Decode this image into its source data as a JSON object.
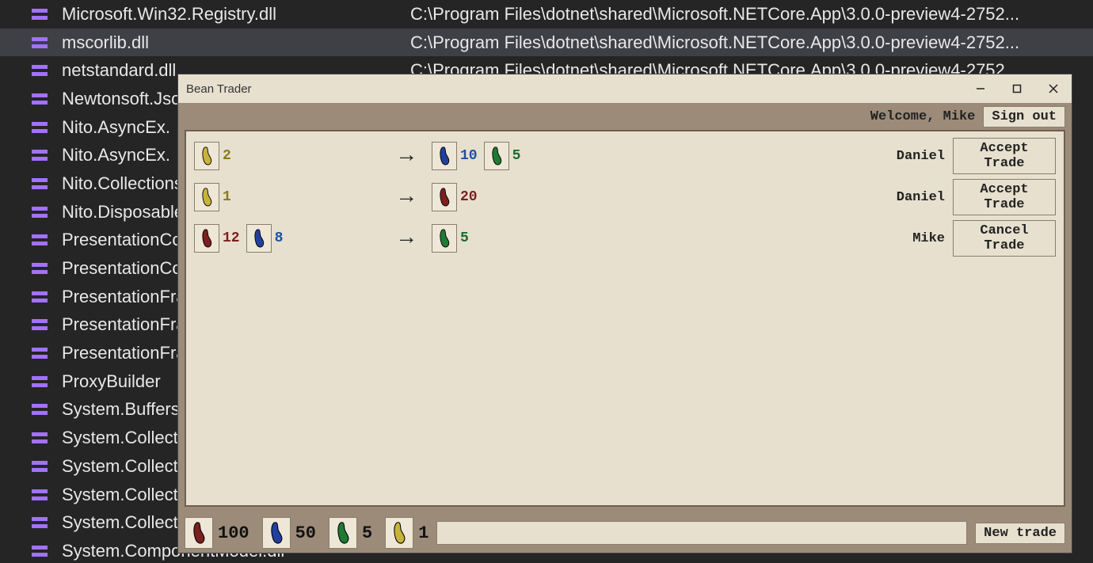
{
  "background": {
    "modules": [
      {
        "name": "Microsoft.Win32.Registry.dll",
        "path": "C:\\Program Files\\dotnet\\shared\\Microsoft.NETCore.App\\3.0.0-preview4-2752...",
        "selected": false
      },
      {
        "name": "mscorlib.dll",
        "path": "C:\\Program Files\\dotnet\\shared\\Microsoft.NETCore.App\\3.0.0-preview4-2752...",
        "selected": true
      },
      {
        "name": "netstandard.dll",
        "path": "C:\\Program Files\\dotnet\\shared\\Microsoft.NETCore.App\\3.0.0-preview4-2752...",
        "selected": false
      },
      {
        "name": "Newtonsoft.Json.dll",
        "path": "",
        "selected": false
      },
      {
        "name": "Nito.AsyncEx.",
        "path": "",
        "selected": false
      },
      {
        "name": "Nito.AsyncEx.",
        "path": "",
        "selected": false
      },
      {
        "name": "Nito.Collections.Deque.dll",
        "path": "",
        "selected": false
      },
      {
        "name": "Nito.Disposables.dll",
        "path": "",
        "selected": false
      },
      {
        "name": "PresentationCore.dll",
        "path": "",
        "selected": false
      },
      {
        "name": "PresentationCore.dll",
        "path": "",
        "selected": false
      },
      {
        "name": "PresentationFramework.dll",
        "path": "",
        "selected": false
      },
      {
        "name": "PresentationFramework.dll",
        "path": "",
        "selected": false
      },
      {
        "name": "PresentationFramework.dll",
        "path": "",
        "selected": false
      },
      {
        "name": "ProxyBuilder",
        "path": "",
        "selected": false
      },
      {
        "name": "System.Buffers.dll",
        "path": "",
        "selected": false
      },
      {
        "name": "System.Collections.dll",
        "path": "",
        "selected": false
      },
      {
        "name": "System.Collections.dll",
        "path": "",
        "selected": false
      },
      {
        "name": "System.Collections.dll",
        "path": "",
        "selected": false
      },
      {
        "name": "System.Collections.dll",
        "path": "",
        "selected": false
      },
      {
        "name": "System.ComponentModel.dll",
        "path": "",
        "selected": false
      }
    ]
  },
  "bean_trader": {
    "title": "Bean Trader",
    "welcome": "Welcome, Mike",
    "sign_out": "Sign out",
    "new_trade": "New trade",
    "arrow": "→",
    "chat_value": "",
    "bean_colors": {
      "yellow": "#c7b33a",
      "blue": "#233f9e",
      "green": "#1f7a33",
      "red": "#7b1f1f"
    },
    "trades": [
      {
        "offer": [
          {
            "color": "yellow",
            "count": "2"
          }
        ],
        "receive": [
          {
            "color": "blue",
            "count": "10"
          },
          {
            "color": "green",
            "count": "5"
          }
        ],
        "trader": "Daniel",
        "action": "Accept Trade"
      },
      {
        "offer": [
          {
            "color": "yellow",
            "count": "1"
          }
        ],
        "receive": [
          {
            "color": "red",
            "count": "20"
          }
        ],
        "trader": "Daniel",
        "action": "Accept Trade"
      },
      {
        "offer": [
          {
            "color": "red",
            "count": "12"
          },
          {
            "color": "blue",
            "count": "8"
          }
        ],
        "receive": [
          {
            "color": "green",
            "count": "5"
          }
        ],
        "trader": "Mike",
        "action": "Cancel Trade"
      }
    ],
    "inventory": [
      {
        "color": "red",
        "count": "100"
      },
      {
        "color": "blue",
        "count": "50"
      },
      {
        "color": "green",
        "count": "5"
      },
      {
        "color": "yellow",
        "count": "1"
      }
    ]
  }
}
